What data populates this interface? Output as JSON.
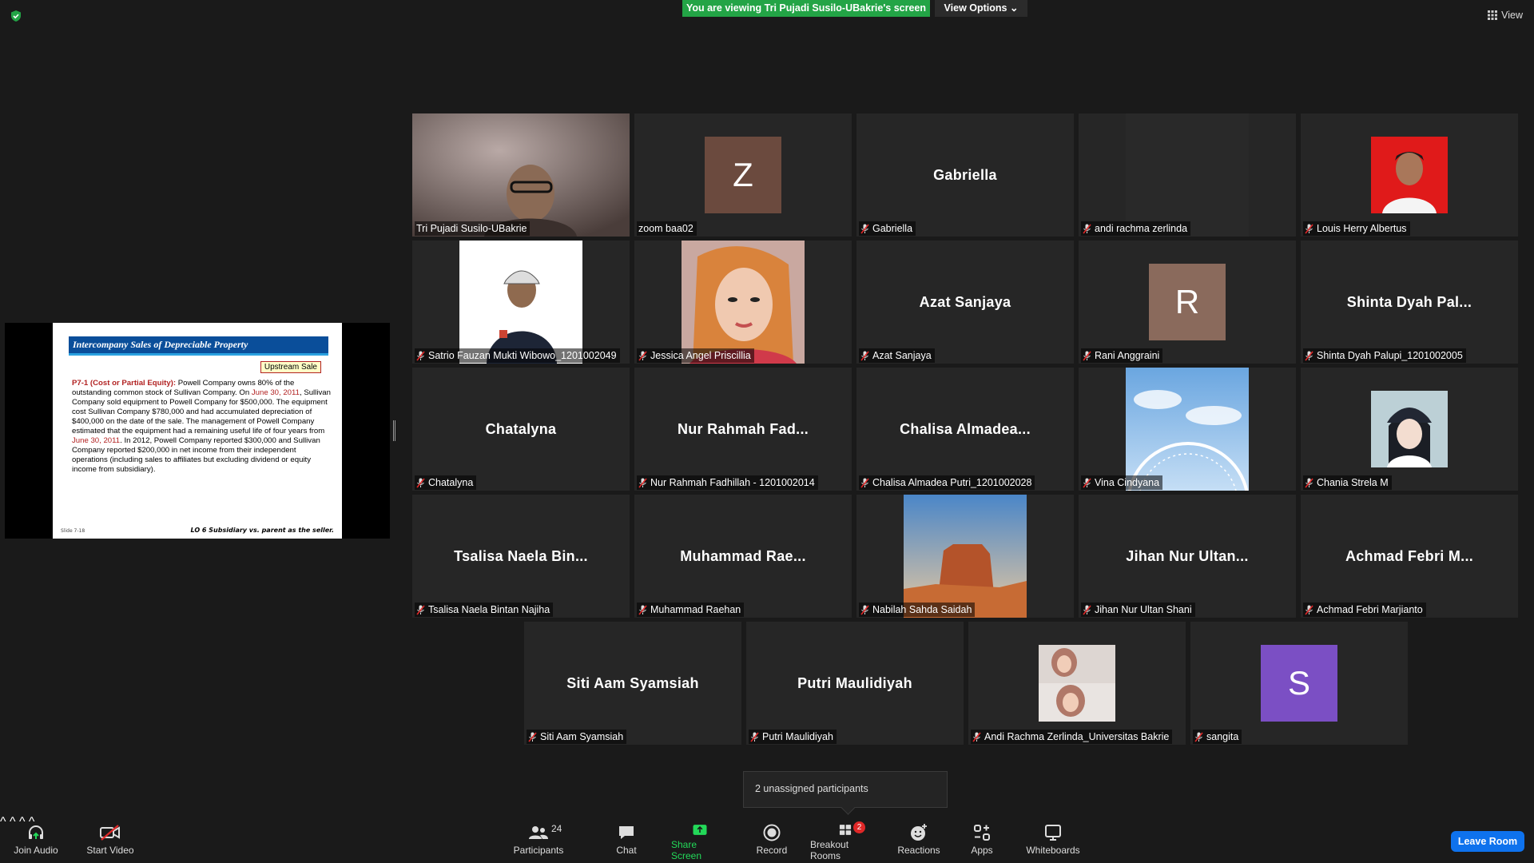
{
  "top": {
    "viewing_banner": "You are viewing Tri Pujadi Susilo-UBakrie's screen",
    "view_options": "View Options",
    "view": "View"
  },
  "slide": {
    "title": "Intercompany Sales of Depreciable Property",
    "badge": "Upstream Sale",
    "lead": "P7-1 (Cost or Partial Equity):",
    "p1": "Powell Company owns 80% of the outstanding common stock of Sullivan Company. On",
    "date1": "June 30, 2011",
    "p2": ", Sullivan Company sold equipment to Powell Company for $500,000. The equipment cost Sullivan Company $780,000 and had accumulated depreciation of $400,000 on the date of the sale. The management of Powell Company estimated that the equipment had a remaining useful life of four years from",
    "date2": "June 30, 2011",
    "p3": ". In 2012, Powell Company reported $300,000 and Sullivan Company reported $200,000 in net income from their independent operations (including sales to affiliates but excluding dividend or equity income from subsidiary).",
    "slide_no": "Slide 7-18",
    "footer": "LO 6  Subsidiary vs. parent as the seller."
  },
  "participants": [
    {
      "label": "Tri Pujadi Susilo-UBakrie",
      "kind": "video",
      "muted": false
    },
    {
      "label": "zoom baa02",
      "kind": "avatar",
      "letter": "Z",
      "color": "#6b4a3e",
      "muted": false
    },
    {
      "label": "Gabriella",
      "kind": "name",
      "big": "Gabriella",
      "muted": true
    },
    {
      "label": "andi rachma zerlinda",
      "kind": "dark",
      "muted": true
    },
    {
      "label": "Louis Herry Albertus",
      "kind": "photo-red",
      "muted": true
    },
    {
      "label": "Satrio Fauzan Mukti Wibowo_1201002049",
      "kind": "photo-man",
      "muted": true
    },
    {
      "label": "Jessica Angel Priscillia",
      "kind": "photo-girl",
      "muted": true
    },
    {
      "label": "Azat Sanjaya",
      "kind": "name",
      "big": "Azat Sanjaya",
      "muted": true
    },
    {
      "label": "Rani Anggraini",
      "kind": "avatar",
      "letter": "R",
      "color": "#8a6a5c",
      "muted": true
    },
    {
      "label": "Shinta Dyah Palupi_1201002005",
      "kind": "name",
      "big": "Shinta Dyah Pal...",
      "muted": true
    },
    {
      "label": "Chatalyna",
      "kind": "name",
      "big": "Chatalyna",
      "muted": true
    },
    {
      "label": "Nur Rahmah Fadhillah - 1201002014",
      "kind": "name",
      "big": "Nur Rahmah Fad...",
      "muted": true
    },
    {
      "label": "Chalisa Almadea Putri_1201002028",
      "kind": "name",
      "big": "Chalisa Almadea...",
      "muted": true
    },
    {
      "label": "Vina Cindyana",
      "kind": "photo-wheel",
      "muted": true
    },
    {
      "label": "Chania Strela M",
      "kind": "photo-anime",
      "muted": true
    },
    {
      "label": "Tsalisa Naela Bintan Najiha",
      "kind": "name",
      "big": "Tsalisa Naela Bin...",
      "muted": true
    },
    {
      "label": "Muhammad Raehan",
      "kind": "name",
      "big": "Muhammad Rae...",
      "muted": true
    },
    {
      "label": "Nabilah Sahda Saidah",
      "kind": "photo-desert",
      "muted": true
    },
    {
      "label": "Jihan Nur Ultan Shani",
      "kind": "name",
      "big": "Jihan Nur Ultan...",
      "muted": true
    },
    {
      "label": "Achmad Febri Marjianto",
      "kind": "name",
      "big": "Achmad Febri M...",
      "muted": true
    },
    {
      "label": "Siti Aam Syamsiah",
      "kind": "name",
      "big": "Siti Aam Syamsiah",
      "muted": true
    },
    {
      "label": "Putri Maulidiyah",
      "kind": "name",
      "big": "Putri Maulidiyah",
      "muted": true
    },
    {
      "label": "Andi Rachma Zerlinda_Universitas Bakrie",
      "kind": "photo-hijab",
      "muted": true
    },
    {
      "label": "sangita",
      "kind": "avatar",
      "letter": "S",
      "color": "#7b4fc4",
      "muted": true
    }
  ],
  "popup": "2 unassigned participants",
  "toolbar": {
    "join_audio": "Join Audio",
    "start_video": "Start Video",
    "participants": "Participants",
    "participants_count": "24",
    "chat": "Chat",
    "share_screen": "Share Screen",
    "record": "Record",
    "breakout_rooms": "Breakout Rooms",
    "breakout_badge": "2",
    "reactions": "Reactions",
    "apps": "Apps",
    "whiteboards": "Whiteboards",
    "leave": "Leave Room"
  },
  "colors": {
    "banner_green": "#23a446",
    "active_speaker": "#d8f06c",
    "share_green": "#23d959",
    "leave_blue": "#0e72ed",
    "mute_red": "#e02828"
  }
}
